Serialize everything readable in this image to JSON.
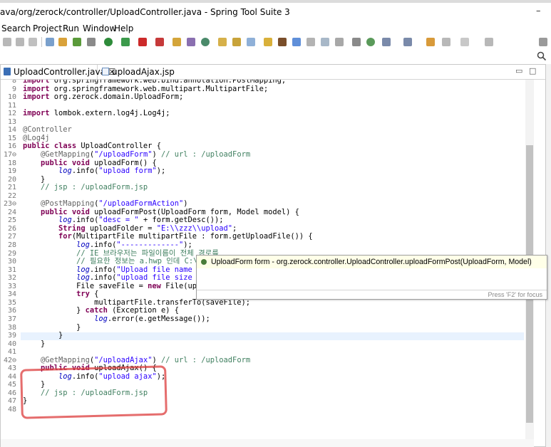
{
  "window": {
    "title": "ava/org/zerock/controller/UploadController.java - Spring Tool Suite 3",
    "minimize": "–"
  },
  "menu": {
    "items": [
      "Search",
      "Project",
      "Run",
      "Window",
      "Help"
    ]
  },
  "tabs": [
    {
      "label": "UploadController.java ☒",
      "active": true
    },
    {
      "label": "uploadAjax.jsp",
      "active": false
    }
  ],
  "editor": {
    "minimize": "▭",
    "maximize": "□"
  },
  "code": {
    "lines": [
      {
        "n": "8",
        "t": "import org.springframework.web.bind.annotation.PostMapping;"
      },
      {
        "n": "9",
        "t": "import org.springframework.web.multipart.MultipartFile;"
      },
      {
        "n": "10",
        "t": "import org.zerock.domain.UploadForm;"
      },
      {
        "n": "11",
        "t": ""
      },
      {
        "n": "12",
        "t": "import lombok.extern.log4j.Log4j;"
      },
      {
        "n": "13",
        "t": ""
      },
      {
        "n": "14",
        "t": "@Controller"
      },
      {
        "n": "15",
        "t": "@Log4j"
      },
      {
        "n": "16",
        "t": "public class UploadController {"
      },
      {
        "n": "17⊖",
        "t": "    @GetMapping(\"/uploadForm\") // url : /uploadForm"
      },
      {
        "n": "18",
        "t": "    public void uploadForm() {"
      },
      {
        "n": "19",
        "t": "        log.info(\"upload form\");"
      },
      {
        "n": "20",
        "t": "    }"
      },
      {
        "n": "21",
        "t": "    // jsp : /uploadForm.jsp"
      },
      {
        "n": "22",
        "t": ""
      },
      {
        "n": "23⊖",
        "t": "    @PostMapping(\"/uploadFormAction\")"
      },
      {
        "n": "24",
        "t": "    public void uploadFormPost(UploadForm form, Model model) {"
      },
      {
        "n": "25",
        "t": "        log.info(\"desc = \" + form.getDesc());"
      },
      {
        "n": "26",
        "t": "        String uploadFolder = \"E:\\\\zzz\\\\upload\";"
      },
      {
        "n": "27",
        "t": "        for(MultipartFile multipartFile : form.getUploadFile()) {"
      },
      {
        "n": "28",
        "t": "            log.info(\"-------------\");"
      },
      {
        "n": "29",
        "t": "            // IE 브라우저는 파일이름이 전체 경로를"
      },
      {
        "n": "30",
        "t": "            // 필요한 정보는 a.hwp 인데 C:\\Users"
      },
      {
        "n": "31",
        "t": "            log.info(\"Upload file name : \""
      },
      {
        "n": "32",
        "t": "            log.info(\"upload file size : \""
      },
      {
        "n": "33",
        "t": "            File saveFile = new File(uploadFolder, multipartFile.getOriginalFilename());"
      },
      {
        "n": "34",
        "t": "            try {"
      },
      {
        "n": "35",
        "t": "                multipartFile.transferTo(saveFile);"
      },
      {
        "n": "36",
        "t": "            } catch (Exception e) {"
      },
      {
        "n": "37",
        "t": "                log.error(e.getMessage());"
      },
      {
        "n": "38",
        "t": "            }"
      },
      {
        "n": "39",
        "t": "        }"
      },
      {
        "n": "40",
        "t": "    }"
      },
      {
        "n": "41",
        "t": ""
      },
      {
        "n": "42⊖",
        "t": "    @GetMapping(\"/uploadAjax\") // url : /uploadForm"
      },
      {
        "n": "43",
        "t": "    public void uploadAjax() {"
      },
      {
        "n": "44",
        "t": "        log.info(\"upload ajax\");"
      },
      {
        "n": "45",
        "t": "    }"
      },
      {
        "n": "46",
        "t": "    // jsp : /uploadForm.jsp"
      },
      {
        "n": "47",
        "t": "}"
      },
      {
        "n": "48",
        "t": ""
      }
    ]
  },
  "tooltip": {
    "text": "UploadForm form - org.zerock.controller.UploadController.uploadFormPost(UploadForm, Model)",
    "footer": "Press 'F2' for focus"
  },
  "colors": {
    "keyword": "#7f0055",
    "string": "#2a00ff",
    "comment": "#3f7f5f",
    "annotation": "#646464",
    "highlight": "#dc3c3c"
  }
}
